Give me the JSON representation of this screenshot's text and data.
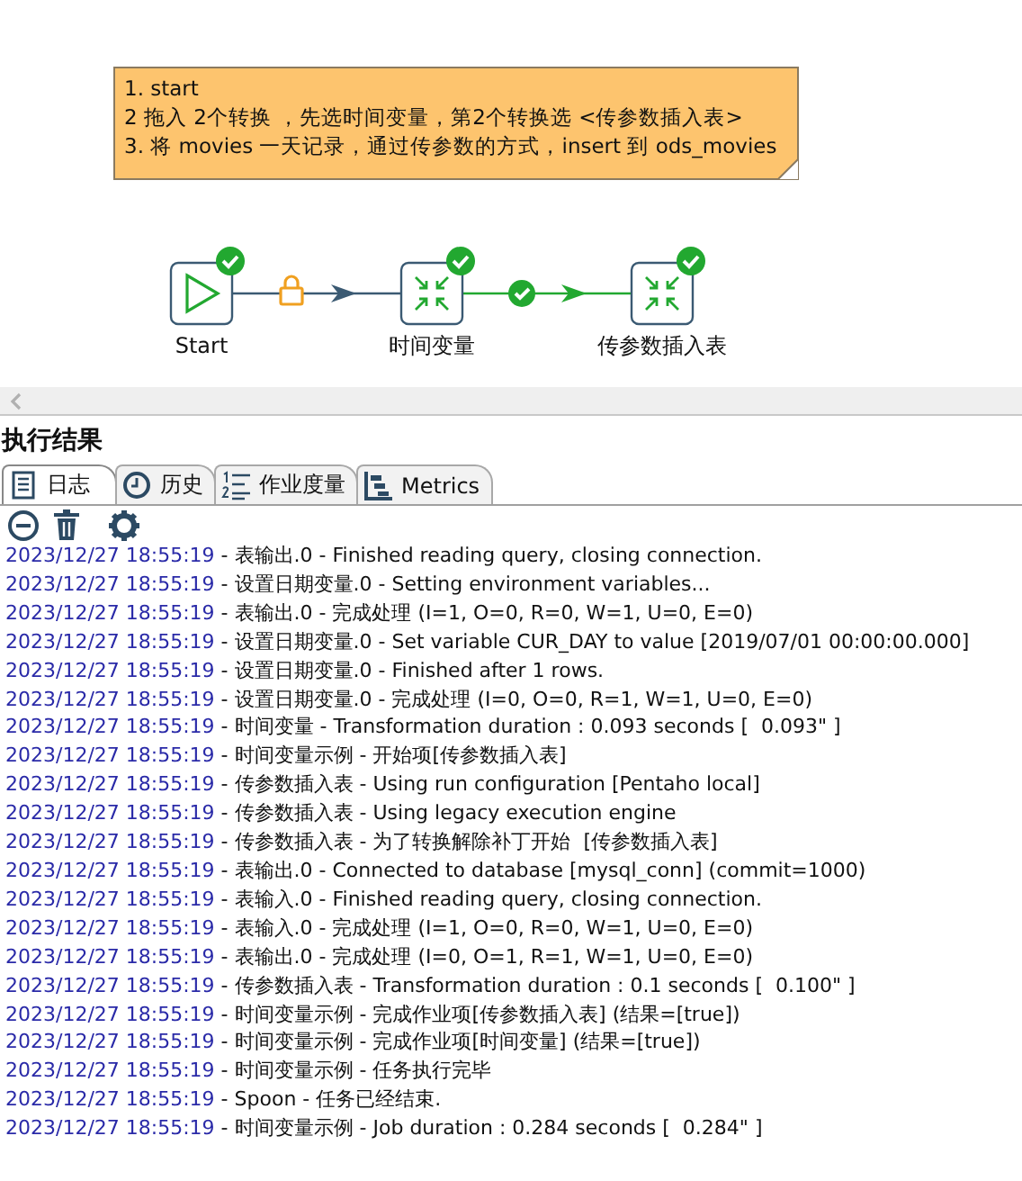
{
  "canvas": {
    "note": {
      "lines": [
        "1. start",
        "2 拖入 2个转换 ，先选时间变量，第2个转换选 <传参数插入表>",
        "3. 将 movies 一天记录，通过传参数的方式，insert 到 ods_movies"
      ]
    },
    "nodes": [
      {
        "label": "Start",
        "kind": "start",
        "succeeded": true
      },
      {
        "label": "时间变量",
        "kind": "transformation",
        "succeeded": true
      },
      {
        "label": "传参数插入表",
        "kind": "transformation",
        "succeeded": true
      }
    ],
    "hops": [
      {
        "kind": "locked"
      },
      {
        "kind": "success"
      }
    ]
  },
  "results": {
    "title": "执行结果",
    "tabs": [
      {
        "label": "日志",
        "selected": true
      },
      {
        "label": "历史",
        "selected": false
      },
      {
        "label": "作业度量",
        "selected": false
      },
      {
        "label": "Metrics",
        "selected": false
      }
    ],
    "log": [
      {
        "time": "2023/12/27 18:55:19",
        "text": " - 表输出.0 - Finished reading query, closing connection."
      },
      {
        "time": "2023/12/27 18:55:19",
        "text": " - 设置日期变量.0 - Setting environment variables..."
      },
      {
        "time": "2023/12/27 18:55:19",
        "text": " - 表输出.0 - 完成处理 (I=1, O=0, R=0, W=1, U=0, E=0)"
      },
      {
        "time": "2023/12/27 18:55:19",
        "text": " - 设置日期变量.0 - Set variable CUR_DAY to value [2019/07/01 00:00:00.000]"
      },
      {
        "time": "2023/12/27 18:55:19",
        "text": " - 设置日期变量.0 - Finished after 1 rows."
      },
      {
        "time": "2023/12/27 18:55:19",
        "text": " - 设置日期变量.0 - 完成处理 (I=0, O=0, R=1, W=1, U=0, E=0)"
      },
      {
        "time": "2023/12/27 18:55:19",
        "text": " - 时间变量 - Transformation duration : 0.093 seconds [  0.093\" ]"
      },
      {
        "time": "2023/12/27 18:55:19",
        "text": " - 时间变量示例 - 开始项[传参数插入表]"
      },
      {
        "time": "2023/12/27 18:55:19",
        "text": " - 传参数插入表 - Using run configuration [Pentaho local]"
      },
      {
        "time": "2023/12/27 18:55:19",
        "text": " - 传参数插入表 - Using legacy execution engine"
      },
      {
        "time": "2023/12/27 18:55:19",
        "text": " - 传参数插入表 - 为了转换解除补丁开始  [传参数插入表]"
      },
      {
        "time": "2023/12/27 18:55:19",
        "text": " - 表输出.0 - Connected to database [mysql_conn] (commit=1000)"
      },
      {
        "time": "2023/12/27 18:55:19",
        "text": " - 表输入.0 - Finished reading query, closing connection."
      },
      {
        "time": "2023/12/27 18:55:19",
        "text": " - 表输入.0 - 完成处理 (I=1, O=0, R=0, W=1, U=0, E=0)"
      },
      {
        "time": "2023/12/27 18:55:19",
        "text": " - 表输出.0 - 完成处理 (I=0, O=1, R=1, W=1, U=0, E=0)"
      },
      {
        "time": "2023/12/27 18:55:19",
        "text": " - 传参数插入表 - Transformation duration : 0.1 seconds [  0.100\" ]"
      },
      {
        "time": "2023/12/27 18:55:19",
        "text": " - 时间变量示例 - 完成作业项[传参数插入表] (结果=[true])"
      },
      {
        "time": "2023/12/27 18:55:19",
        "text": " - 时间变量示例 - 完成作业项[时间变量] (结果=[true])"
      },
      {
        "time": "2023/12/27 18:55:19",
        "text": " - 时间变量示例 - 任务执行完毕"
      },
      {
        "time": "2023/12/27 18:55:19",
        "text": " - Spoon - 任务已经结束."
      },
      {
        "time": "2023/12/27 18:55:19",
        "text": " - 时间变量示例 - Job duration : 0.284 seconds [  0.284\" ]"
      }
    ]
  }
}
